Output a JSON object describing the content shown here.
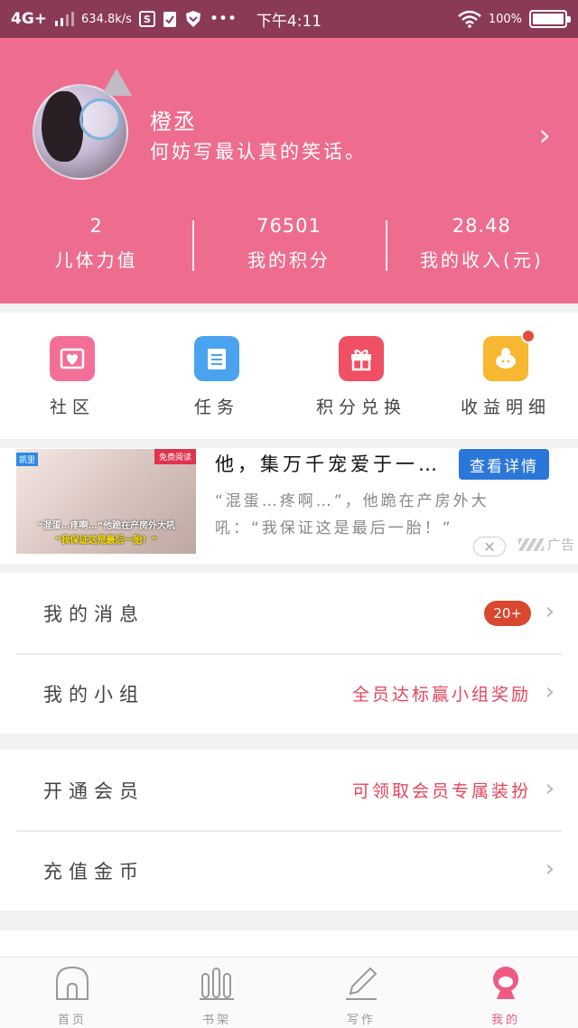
{
  "status_bar": {
    "network": "4G+",
    "speed": "634.8k/s",
    "time": "下午4:11",
    "battery": "100%",
    "dots": "•••",
    "s_icon_text": "S"
  },
  "profile": {
    "name": "橙丞",
    "signature": "何妨写最认真的笑话。",
    "chevron": "›",
    "stats": [
      {
        "value": "2",
        "label": "儿体力值"
      },
      {
        "value": "76501",
        "label": "我的积分"
      },
      {
        "value": "28.48",
        "label": "我的收入(元)"
      }
    ]
  },
  "grid": [
    {
      "label": "社区",
      "icon": "heart-envelope-icon",
      "color": "#f36f98"
    },
    {
      "label": "任务",
      "icon": "task-list-icon",
      "color": "#4aa3ee"
    },
    {
      "label": "积分兑换",
      "icon": "gift-icon",
      "color": "#ef5064"
    },
    {
      "label": "收益明细",
      "icon": "piggy-bank-icon",
      "color": "#f7b731"
    }
  ],
  "ad": {
    "title": "他，集万千宠爱于一…",
    "button": "查看详情",
    "description": "“混蛋…疼啊…”，他跪在产房外大吼：“我保证这是最后一胎！”",
    "img_tag": "凯里",
    "img_badge": "免费阅读",
    "img_caption1": "“混蛋…疼啊…”他跪在产房外大吼",
    "img_caption2": "“我保证这是最后一胎！”",
    "close": "✕",
    "mark": "广告"
  },
  "group1": [
    {
      "label": "我的消息",
      "badge": "20+"
    },
    {
      "label": "我的小组",
      "right": "全员达标赢小组奖励"
    }
  ],
  "group2": [
    {
      "label": "开通会员",
      "right": "可领取会员专属装扮"
    },
    {
      "label": "充值金币"
    }
  ],
  "chevron": "›",
  "bottom_nav": [
    {
      "label": "首页",
      "icon": "home-icon"
    },
    {
      "label": "书架",
      "icon": "bookshelf-icon"
    },
    {
      "label": "写作",
      "icon": "pencil-icon"
    },
    {
      "label": "我的",
      "icon": "profile-icon",
      "active": true
    }
  ],
  "colors": {
    "header_pink": "#ee6d8e",
    "status_bar": "#8b3a55",
    "accent_red": "#e6455b",
    "badge": "#d9482e",
    "ad_button": "#2b77d9",
    "nav_active": "#ee5a84"
  }
}
